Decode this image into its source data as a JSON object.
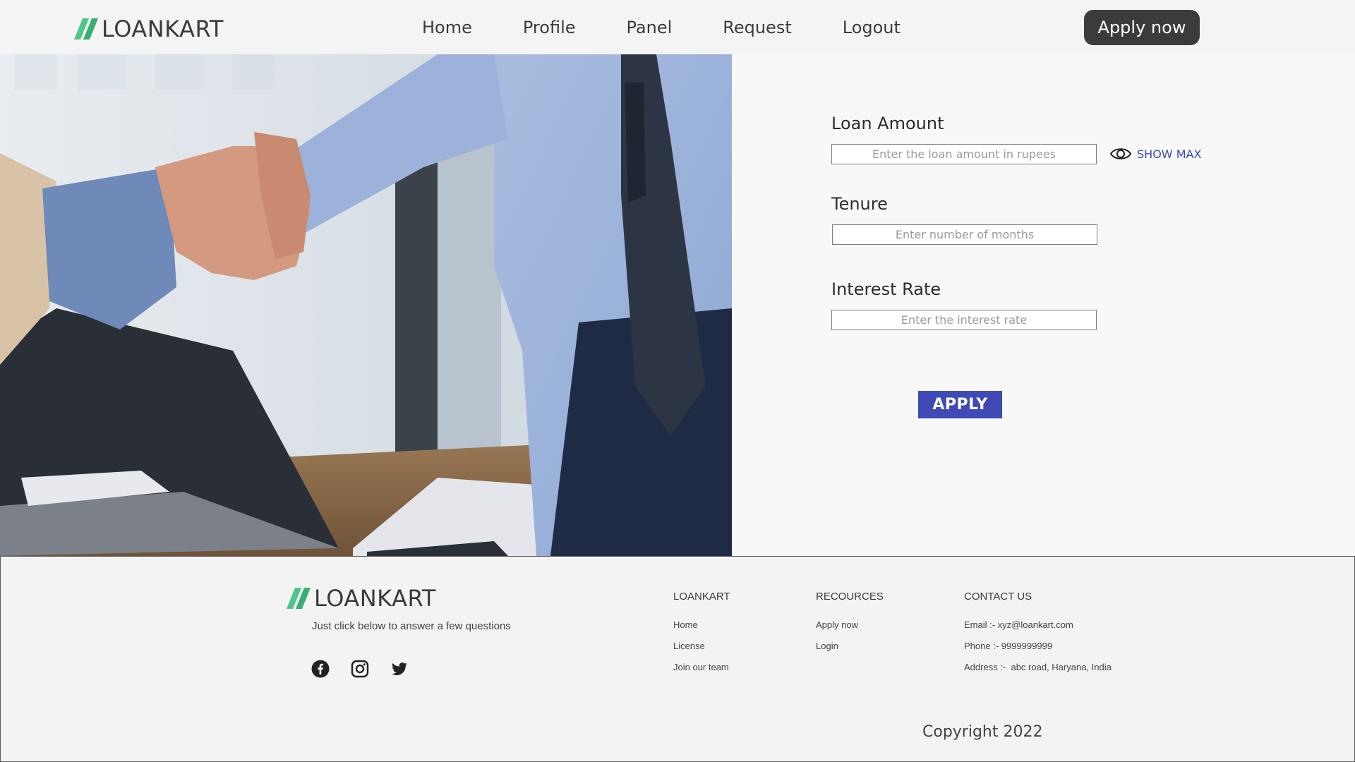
{
  "brand": {
    "name": "LOANKART",
    "accent_color": "#3dba7e"
  },
  "nav": {
    "items": [
      "Home",
      "Profile",
      "Panel",
      "Request",
      "Logout"
    ],
    "apply_label": "Apply now"
  },
  "form": {
    "loan_amount": {
      "label": "Loan Amount",
      "placeholder": "Enter the loan amount in rupees",
      "value": ""
    },
    "show_max_label": "SHOW MAX",
    "tenure": {
      "label": "Tenure",
      "placeholder": "Enter number of months",
      "value": ""
    },
    "interest": {
      "label": "Interest Rate",
      "placeholder": "Enter the interest rate",
      "value": ""
    },
    "apply_label": "APPLY",
    "apply_color": "#3f4ab5"
  },
  "footer": {
    "brand": "LOANKART",
    "tagline": "Just click below to answer a few questions",
    "social_icons": [
      "facebook-icon",
      "instagram-icon",
      "twitter-icon"
    ],
    "columns": [
      {
        "title": "LOANKART",
        "links": [
          "Home",
          "License",
          "Join our team"
        ]
      },
      {
        "title": "RECOURCES",
        "links": [
          "Apply now",
          "Login"
        ]
      },
      {
        "title": "CONTACT US",
        "links": [
          "Email :- xyz@loankart.com",
          "Phone :- 9999999999",
          "Address :-  abc road, Haryana, India"
        ]
      }
    ],
    "copyright": "Copyright 2022"
  }
}
